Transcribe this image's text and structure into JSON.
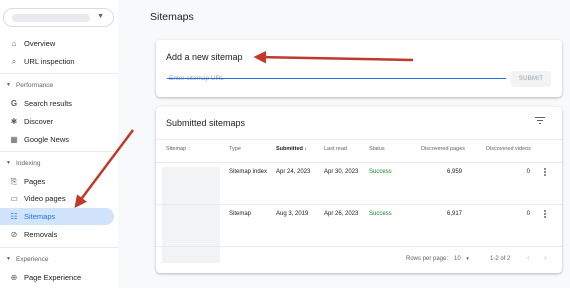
{
  "sidebar": {
    "property_selector": {
      "caret_icon": "dropdown-caret"
    },
    "top_items": [
      {
        "label": "Overview",
        "icon": "home-icon"
      },
      {
        "label": "URL inspection",
        "icon": "search-icon"
      }
    ],
    "sections": [
      {
        "title": "Performance",
        "items": [
          {
            "label": "Search results",
            "icon": "google-g-icon"
          },
          {
            "label": "Discover",
            "icon": "asterisk-icon"
          },
          {
            "label": "Google News",
            "icon": "news-icon"
          }
        ]
      },
      {
        "title": "Indexing",
        "items": [
          {
            "label": "Pages",
            "icon": "pages-icon"
          },
          {
            "label": "Video pages",
            "icon": "video-pages-icon"
          },
          {
            "label": "Sitemaps",
            "icon": "sitemaps-icon",
            "active": true
          },
          {
            "label": "Removals",
            "icon": "removals-icon"
          }
        ]
      },
      {
        "title": "Experience",
        "items": [
          {
            "label": "Page Experience",
            "icon": "page-experience-icon"
          }
        ]
      }
    ]
  },
  "main": {
    "page_title": "Sitemaps",
    "add_sitemap": {
      "title": "Add a new sitemap",
      "placeholder": "Enter sitemap URL",
      "submit_label": "SUBMIT"
    },
    "submitted": {
      "title": "Submitted sitemaps",
      "columns": [
        "Sitemap",
        "Type",
        "Submitted",
        "Last read",
        "Status",
        "Discovered pages",
        "Discovered videos"
      ],
      "sort_icons": {
        "sitemap": "↕",
        "submitted": "↓"
      },
      "rows": [
        {
          "type": "Sitemap index",
          "submitted": "Apr 24, 2023",
          "last_read": "Apr 30, 2023",
          "status": "Success",
          "pages": "6,959",
          "videos": "0"
        },
        {
          "type": "Sitemap",
          "submitted": "Aug 3, 2019",
          "last_read": "Apr 26, 2023",
          "status": "Success",
          "pages": "6,917",
          "videos": "0"
        }
      ],
      "pagination": {
        "rows_per_page_label": "Rows per page:",
        "rows_per_page_value": "10",
        "range": "1-2 of 2",
        "prev": "‹",
        "next": "›"
      }
    }
  },
  "colors": {
    "accent": "#1a73e8",
    "active_nav_bg": "#d2e3fc",
    "success": "#188038",
    "annotation_arrow": "#c0392b"
  }
}
